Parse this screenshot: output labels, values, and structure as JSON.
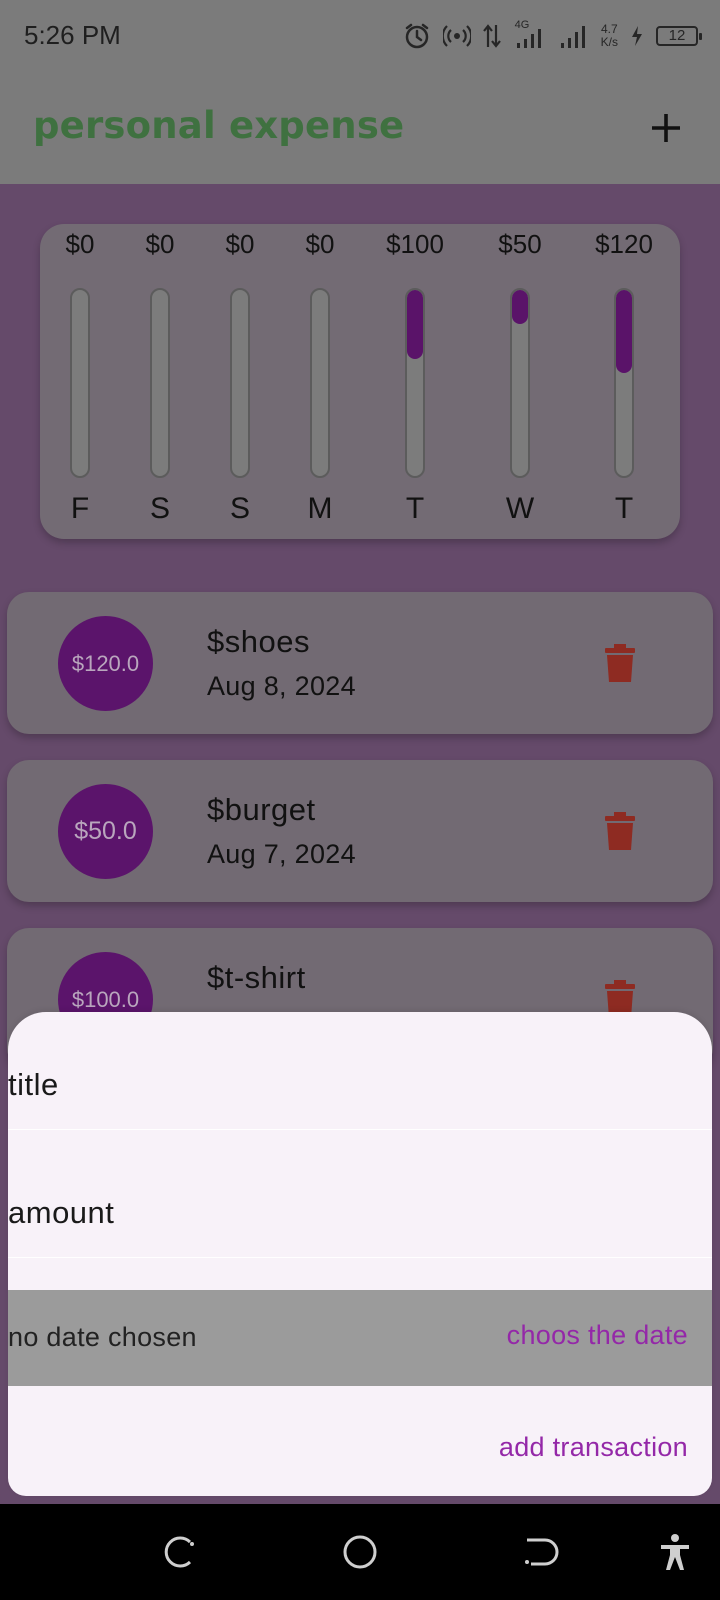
{
  "status_bar": {
    "time": "5:26 PM",
    "net_type": "4G",
    "net_speed_value": "4.7",
    "net_speed_unit": "K/s",
    "battery": "12"
  },
  "app_bar": {
    "title": "personal expense",
    "title_color": "#3f7140",
    "add_icon": "plus-icon"
  },
  "chart": {
    "bars": [
      {
        "amount": "$0",
        "day": "F",
        "fraction": 0
      },
      {
        "amount": "$0",
        "day": "S",
        "fraction": 0
      },
      {
        "amount": "$0",
        "day": "S",
        "fraction": 0
      },
      {
        "amount": "$0",
        "day": "M",
        "fraction": 0
      },
      {
        "amount": "$100",
        "day": "T",
        "fraction": 0.3704
      },
      {
        "amount": "$50",
        "day": "W",
        "fraction": 0.1852
      },
      {
        "amount": "$120",
        "day": "T",
        "fraction": 0.4444
      }
    ],
    "fill_color": "#5a1369"
  },
  "transactions": [
    {
      "amount": "$120.0",
      "title": "$shoes",
      "date": "Aug 8, 2024",
      "delete_icon": "trash-icon"
    },
    {
      "amount": "$50.0",
      "title": "$burget",
      "date": "Aug 7, 2024",
      "delete_icon": "trash-icon"
    },
    {
      "amount": "$100.0",
      "title": "$t-shirt",
      "date": "",
      "delete_icon": "trash-icon"
    }
  ],
  "sheet": {
    "title_placeholder": "title",
    "amount_placeholder": "amount",
    "date_label": "no date chosen",
    "choose_date_label": "choos the date",
    "submit_label": "add transaction",
    "accent_color": "#9428a8"
  },
  "nav_bar": {
    "icons": [
      "recents-icon",
      "home-icon",
      "back-icon",
      "accessibility-icon"
    ]
  }
}
